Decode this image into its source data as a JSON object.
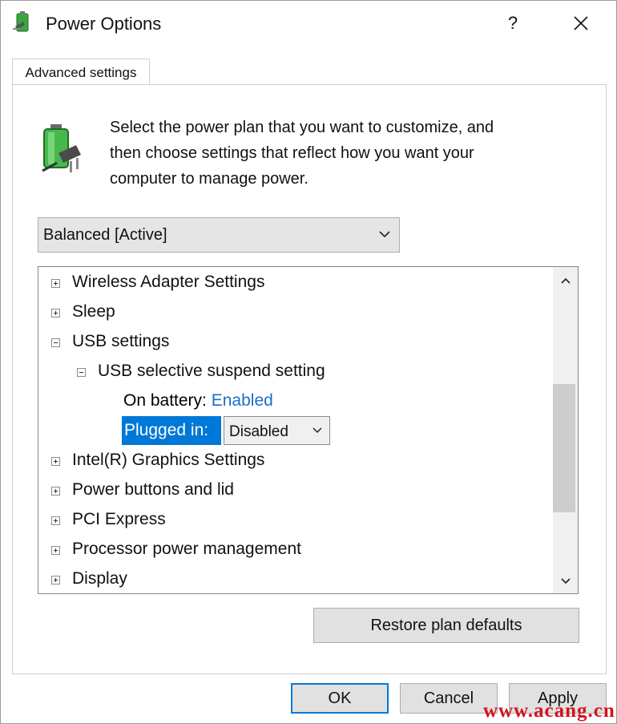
{
  "window": {
    "title": "Power Options",
    "help_label": "?",
    "close_icon": "close-icon"
  },
  "tabs": [
    {
      "label": "Advanced settings",
      "active": true
    }
  ],
  "description": {
    "lines": [
      "Select the power plan that you want to customize, and",
      "then choose settings that reflect how you want your",
      "computer to manage power."
    ]
  },
  "plan_select": {
    "value": "Balanced [Active]"
  },
  "settings_tree": {
    "items": [
      {
        "label": "Wireless Adapter Settings",
        "expanded": false
      },
      {
        "label": "Sleep",
        "expanded": false
      },
      {
        "label": "USB settings",
        "expanded": true
      },
      {
        "label": "USB selective suspend setting",
        "expanded": true
      },
      {
        "label": "Intel(R) Graphics Settings",
        "expanded": false
      },
      {
        "label": "Power buttons and lid",
        "expanded": false
      },
      {
        "label": "PCI Express",
        "expanded": false
      },
      {
        "label": "Processor power management",
        "expanded": false
      },
      {
        "label": "Display",
        "expanded": false
      }
    ],
    "on_battery": {
      "label": "On battery:",
      "value": "Enabled"
    },
    "plugged_in": {
      "label": "Plugged in:",
      "value": "Disabled"
    }
  },
  "buttons": {
    "restore": "Restore plan defaults",
    "ok": "OK",
    "cancel": "Cancel",
    "apply": "Apply"
  },
  "watermark": "www.acang.cn",
  "colors": {
    "accent": "#0078d7",
    "link": "#1a6fc9",
    "watermark": "#d4141c"
  }
}
